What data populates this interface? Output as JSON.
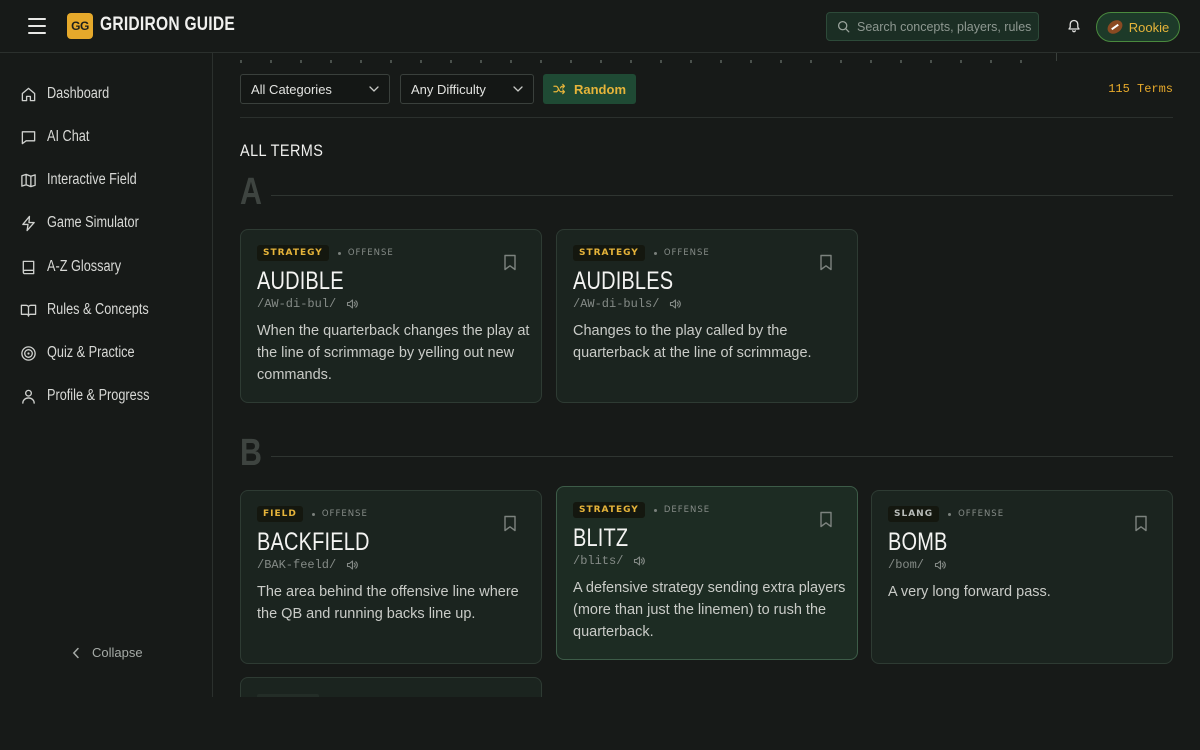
{
  "header": {
    "logo_text": "GG",
    "brand": "GRIDIRON GUIDE",
    "search_placeholder": "Search concepts, players, rules",
    "user_level": "Rookie"
  },
  "sidebar": {
    "items": [
      {
        "label": "Dashboard",
        "icon": "home-icon"
      },
      {
        "label": "AI Chat",
        "icon": "chat-icon"
      },
      {
        "label": "Interactive Field",
        "icon": "map-icon"
      },
      {
        "label": "Game Simulator",
        "icon": "lightning-icon"
      },
      {
        "label": "A-Z Glossary",
        "icon": "book-icon"
      },
      {
        "label": "Rules & Concepts",
        "icon": "open-book-icon"
      },
      {
        "label": "Quiz & Practice",
        "icon": "target-icon"
      },
      {
        "label": "Profile & Progress",
        "icon": "user-icon"
      }
    ],
    "collapse_label": "Collapse"
  },
  "filters": {
    "category": "All Categories",
    "difficulty": "Any Difficulty",
    "random_label": "Random",
    "terms_count": "115 Terms"
  },
  "section_title": "ALL TERMS",
  "groups": [
    {
      "letter": "A",
      "terms": [
        {
          "category": "STRATEGY",
          "side": "OFFENSE",
          "term": "AUDIBLE",
          "pronunciation": "/AW-di-bul/",
          "definition": "When the quarterback changes the play at the line of scrimmage by yelling out new commands."
        },
        {
          "category": "STRATEGY",
          "side": "OFFENSE",
          "term": "AUDIBLES",
          "pronunciation": "/AW-di-buls/",
          "definition": "Changes to the play called by the quarterback at the line of scrimmage."
        }
      ]
    },
    {
      "letter": "B",
      "terms": [
        {
          "category": "FIELD",
          "side": "OFFENSE",
          "term": "BACKFIELD",
          "pronunciation": "/BAK-feeld/",
          "definition": "The area behind the offensive line where the QB and running backs line up."
        },
        {
          "category": "STRATEGY",
          "side": "DEFENSE",
          "term": "BLITZ",
          "pronunciation": "/blits/",
          "definition": "A defensive strategy sending extra players (more than just the linemen) to rush the quarterback."
        },
        {
          "category": "SLANG",
          "side": "OFFENSE",
          "term": "BOMB",
          "pronunciation": "/bom/",
          "definition": "A very long forward pass."
        }
      ]
    }
  ],
  "colors": {
    "accent": "#e6a92b",
    "background": "#171a18",
    "card": "#1b241f",
    "brand_green": "#1f4a34"
  }
}
